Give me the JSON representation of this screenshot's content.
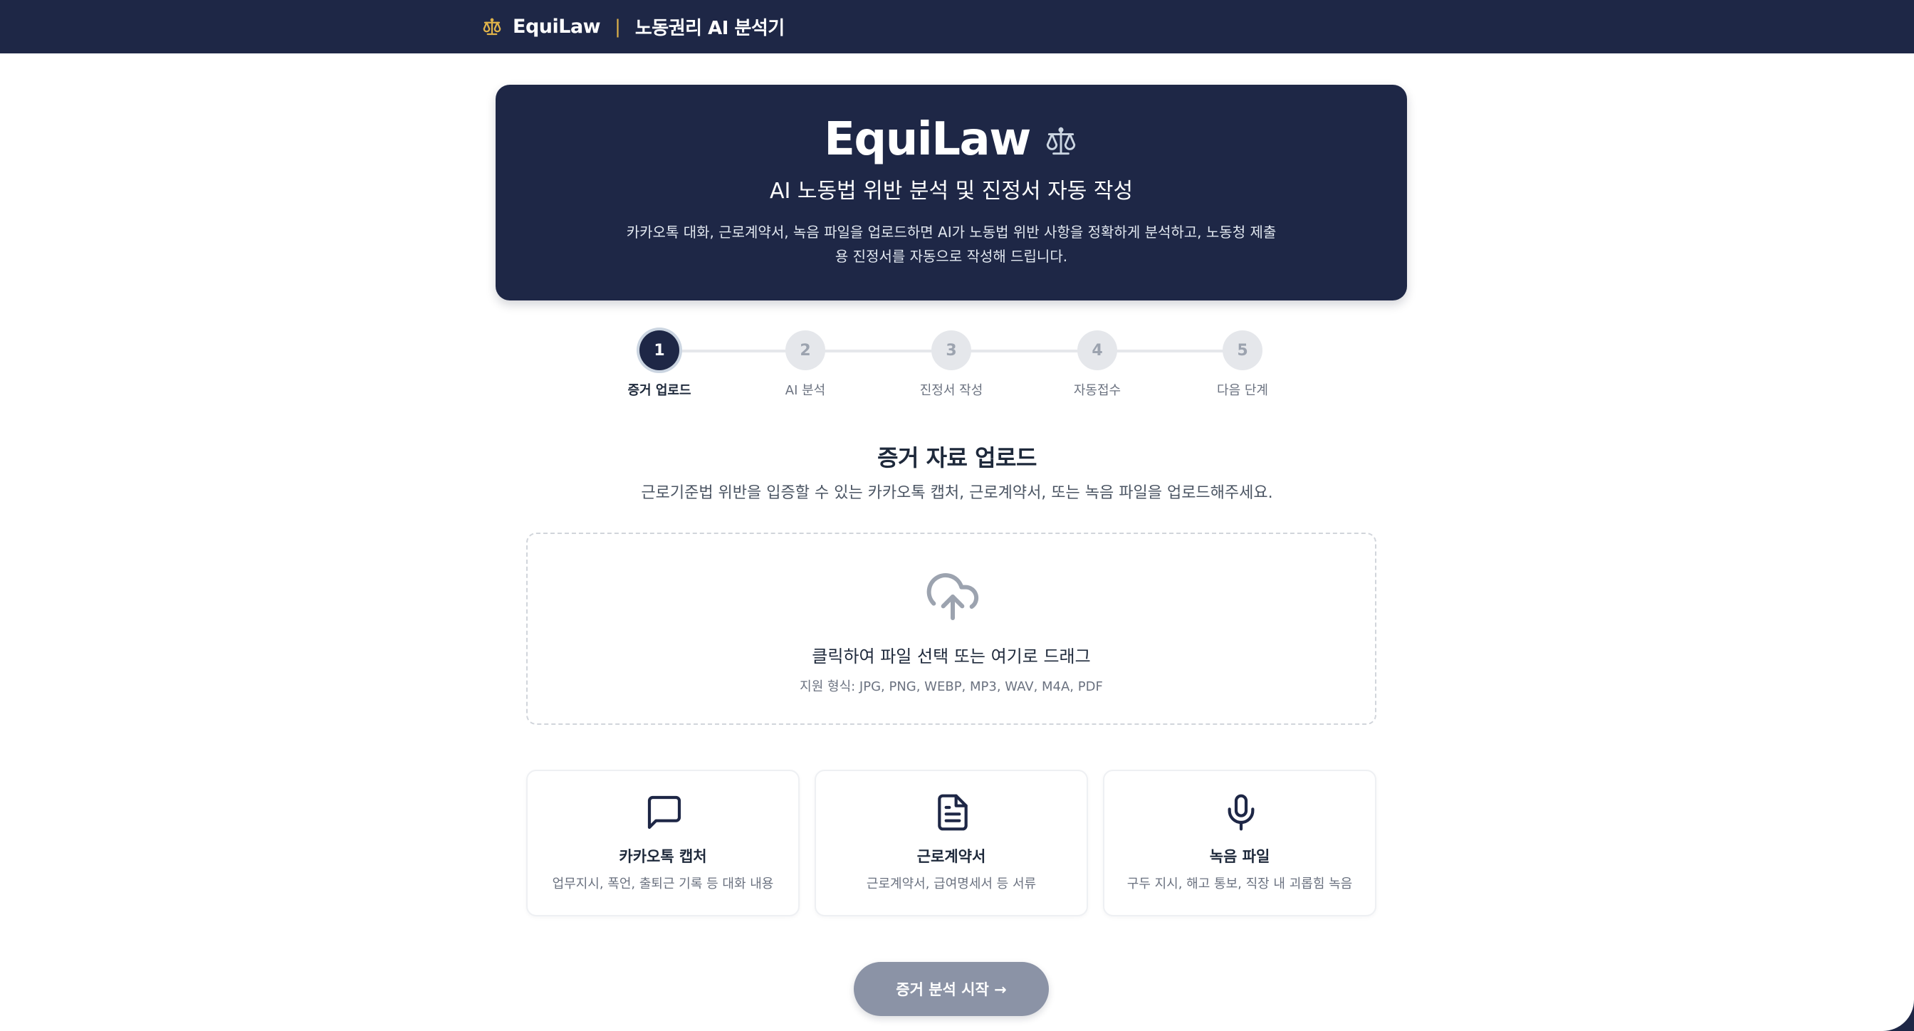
{
  "header": {
    "brand_name": "EquiLaw",
    "separator": "|",
    "subtitle": "노동권리 AI 분석기",
    "brand_color": "#e0b34a"
  },
  "hero": {
    "title": "EquiLaw",
    "title_icon": "scales-icon",
    "subtitle": "AI 노동법 위반 분석 및 진정서 자동 작성",
    "description": "카카오톡 대화, 근로계약서, 녹음 파일을 업로드하면 AI가 노동법 위반 사항을 정확하게 분석하고, 노동청 제출용 진정서를 자동으로 작성해 드립니다."
  },
  "steps": [
    {
      "number": "1",
      "label": "증거 업로드",
      "active": true
    },
    {
      "number": "2",
      "label": "AI 분석",
      "active": false
    },
    {
      "number": "3",
      "label": "진정서 작성",
      "active": false
    },
    {
      "number": "4",
      "label": "자동접수",
      "active": false
    },
    {
      "number": "5",
      "label": "다음 단계",
      "active": false
    }
  ],
  "upload_section": {
    "title": "증거 자료 업로드",
    "description": "근로기준법 위반을 입증할 수 있는 카카오톡 캡처, 근로계약서, 또는 녹음 파일을 업로드해주세요.",
    "dropzone_title": "클릭하여 파일 선택 또는 여기로 드래그",
    "dropzone_hint": "지원 형식: JPG, PNG, WEBP, MP3, WAV, M4A, PDF"
  },
  "cards": [
    {
      "icon": "chat-bubble-icon",
      "title": "카카오톡 캡처",
      "description": "업무지시, 폭언, 출퇴근 기록 등 대화 내용"
    },
    {
      "icon": "document-icon",
      "title": "근로계약서",
      "description": "근로계약서, 급여명세서 등 서류"
    },
    {
      "icon": "microphone-icon",
      "title": "녹음 파일",
      "description": "구두 지시, 해고 통보, 직장 내 괴롭힘 녹음"
    }
  ],
  "actions": {
    "start_label": "증거 분석 시작 →"
  },
  "colors": {
    "navy": "#1e2746",
    "button_disabled": "#8b93a6"
  }
}
